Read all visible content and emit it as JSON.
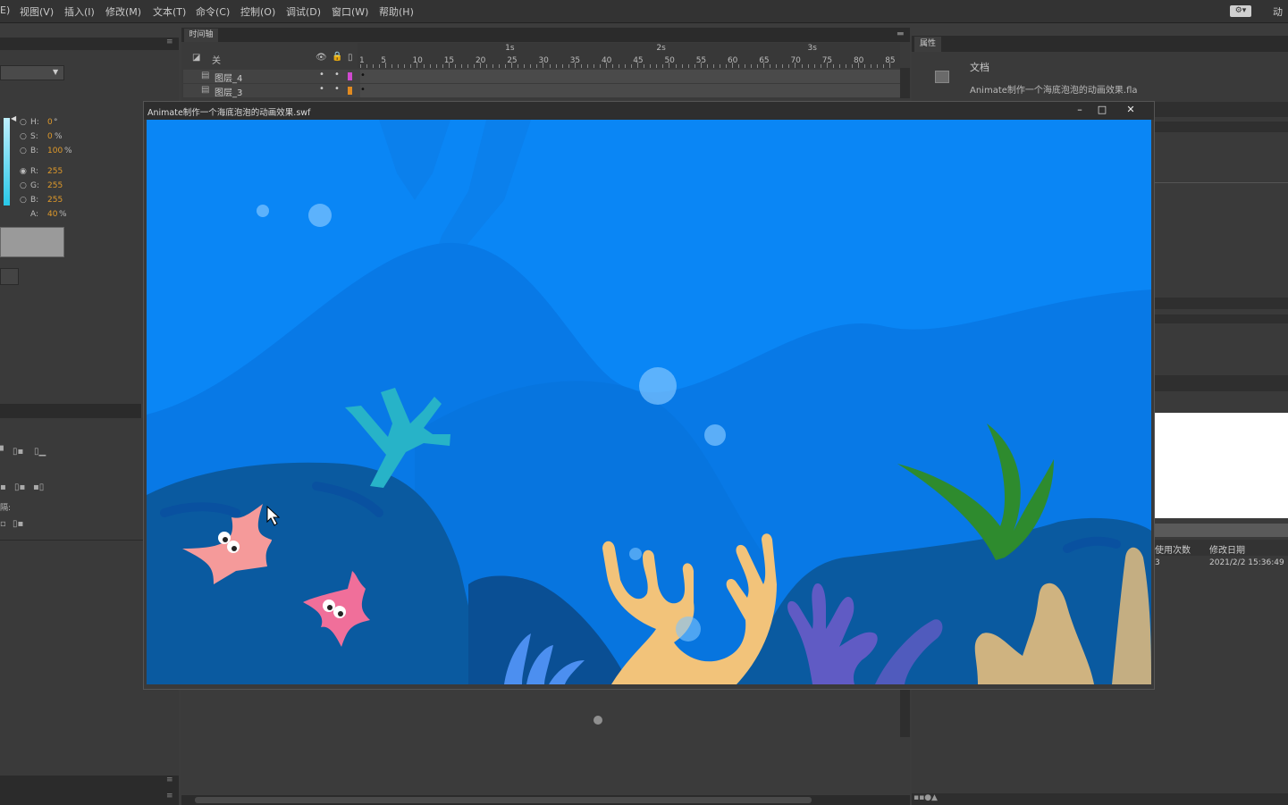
{
  "menu": {
    "items": [
      "E)",
      "视图(V)",
      "插入(I)",
      "修改(M)",
      "文本(T)",
      "命令(C)",
      "控制(O)",
      "调试(D)",
      "窗口(W)",
      "帮助(H)"
    ],
    "workspace_label": "动"
  },
  "color_panel": {
    "h_label": "H:",
    "h_value": "0",
    "h_unit": "°",
    "s_label": "S:",
    "s_value": "0",
    "s_unit": "%",
    "b_label": "B:",
    "b_value": "100",
    "b_unit": "%",
    "r_label": "R:",
    "r_value": "255",
    "g_label": "G:",
    "g_value": "255",
    "bb_label": "B:",
    "bb_value": "255",
    "a_label": "A:",
    "a_value": "40",
    "a_unit": "%"
  },
  "align_panel": {
    "spacing_label": "隔:"
  },
  "timeline": {
    "tab_label": "时间轴",
    "layer_header": "关",
    "layers": [
      {
        "name": "图层_4",
        "color": "#d04ad0"
      },
      {
        "name": "图层_3",
        "color": "#e08a20"
      }
    ],
    "frame_numbers": [
      "1",
      "5",
      "10",
      "15",
      "20",
      "25",
      "30",
      "35",
      "40",
      "45",
      "50",
      "55",
      "60",
      "65",
      "70",
      "75",
      "80",
      "85"
    ],
    "seconds": [
      "1s",
      "2s",
      "3s"
    ]
  },
  "properties": {
    "tab_label": "属性",
    "doc_label": "文档",
    "file_name": "Animate制作一个海底泡泡的动画效果.fla"
  },
  "library": {
    "col_uses": "使用次数",
    "col_date": "修改日期",
    "row_uses": "3",
    "row_date": "2021/2/2 15:36:49"
  },
  "swf_window": {
    "title": "Animate制作一个海底泡泡的动画效果.swf",
    "minimize": "–",
    "maximize": "□",
    "close": "✕"
  },
  "scene_colors": {
    "water": "#0a86f5",
    "rock_dark": "#0a5aa0",
    "seaweed_teal": "#27b3c8",
    "seaweed_green": "#2e8b2e",
    "coral_yellow": "#f2c37a",
    "coral_purple": "#7e5cd0",
    "starfish_pink": "#f59a9a"
  }
}
